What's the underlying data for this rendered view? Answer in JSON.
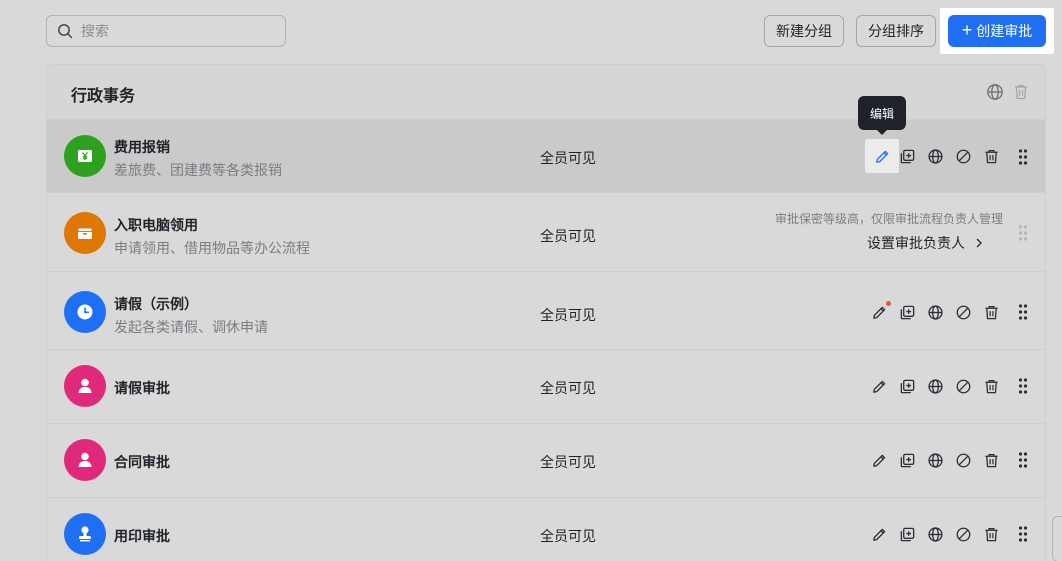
{
  "toolbar": {
    "search_placeholder": "搜索",
    "new_group_label": "新建分组",
    "sort_group_label": "分组排序",
    "create_label": "创建审批"
  },
  "group": {
    "title": "行政事务"
  },
  "tooltip": {
    "text": "编辑"
  },
  "rows": [
    {
      "name": "费用报销",
      "desc": "差旅费、团建费等各类报销",
      "visibility": "全员可见",
      "avatar_color": "#2ea121",
      "icon": "yen-icon"
    },
    {
      "name": "入职电脑领用",
      "desc": "申请领用、借用物品等办公流程",
      "visibility": "全员可见",
      "avatar_color": "#de7802",
      "icon": "box-icon",
      "notice": "审批保密等级高，仅限审批流程负责人管理",
      "owner_link": "设置审批负责人"
    },
    {
      "name": "请假（示例）",
      "desc": "发起各类请假、调休申请",
      "visibility": "全员可见",
      "avatar_color": "#1f6ff5",
      "icon": "clock-icon"
    },
    {
      "name": "请假审批",
      "visibility": "全员可见",
      "avatar_color": "#e0297a",
      "icon": "person-icon"
    },
    {
      "name": "合同审批",
      "visibility": "全员可见",
      "avatar_color": "#e0297a",
      "icon": "person-icon"
    },
    {
      "name": "用印审批",
      "visibility": "全员可见",
      "avatar_color": "#1f6ff5",
      "icon": "stamp-icon"
    }
  ],
  "colors": {
    "primary": "#1f6ff5",
    "badge_red": "#f54a45"
  }
}
